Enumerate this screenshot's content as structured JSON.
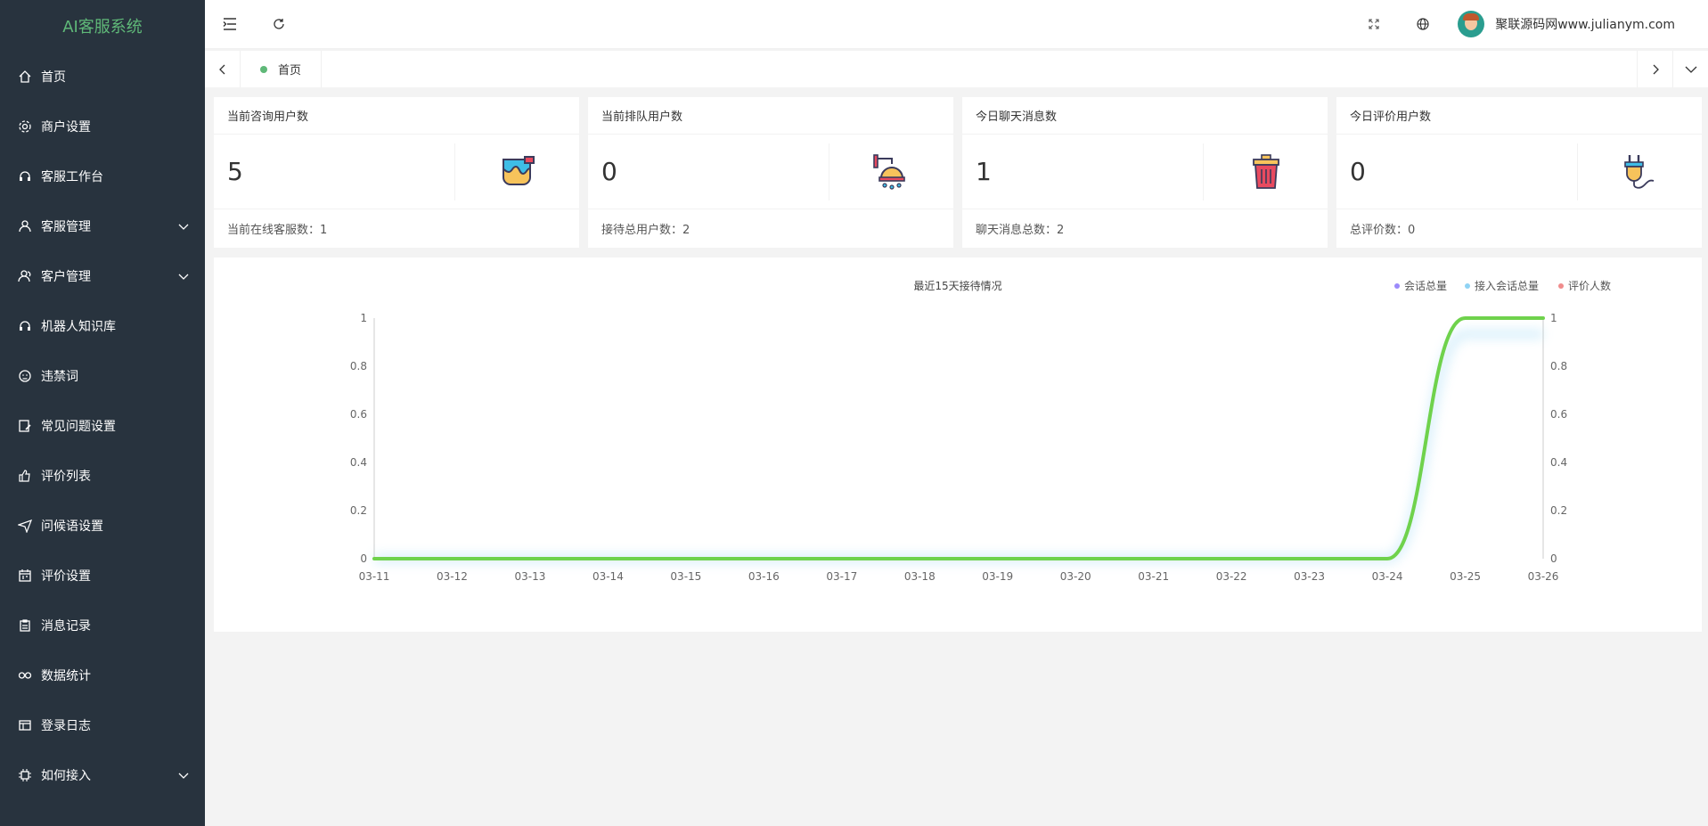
{
  "app": {
    "title": "AI客服系统"
  },
  "sidebar": {
    "items": [
      {
        "label": "首页",
        "icon": "home-icon",
        "expandable": false
      },
      {
        "label": "商户设置",
        "icon": "gear-icon",
        "expandable": false
      },
      {
        "label": "客服工作台",
        "icon": "headset-icon",
        "expandable": false
      },
      {
        "label": "客服管理",
        "icon": "user-icon",
        "expandable": true
      },
      {
        "label": "客户管理",
        "icon": "users-icon",
        "expandable": true
      },
      {
        "label": "机器人知识库",
        "icon": "robot-icon",
        "expandable": false
      },
      {
        "label": "违禁词",
        "icon": "face-icon",
        "expandable": false
      },
      {
        "label": "常见问题设置",
        "icon": "edit-icon",
        "expandable": false
      },
      {
        "label": "评价列表",
        "icon": "thumb-up-icon",
        "expandable": false
      },
      {
        "label": "问候语设置",
        "icon": "paper-plane-icon",
        "expandable": false
      },
      {
        "label": "评价设置",
        "icon": "calendar-icon",
        "expandable": false
      },
      {
        "label": "消息记录",
        "icon": "clipboard-icon",
        "expandable": false
      },
      {
        "label": "数据统计",
        "icon": "link-icon",
        "expandable": false
      },
      {
        "label": "登录日志",
        "icon": "table-icon",
        "expandable": false
      },
      {
        "label": "如何接入",
        "icon": "chip-icon",
        "expandable": true
      }
    ]
  },
  "header": {
    "user_name": "聚联源码网www.julianym.com"
  },
  "tabs": [
    {
      "label": "首页",
      "active": true
    }
  ],
  "cards": [
    {
      "title": "当前咨询用户数",
      "value": "5",
      "footer": "当前在线客服数：1",
      "icon": "paint-bucket-icon"
    },
    {
      "title": "当前排队用户数",
      "value": "0",
      "footer": "接待总用户数：2",
      "icon": "shower-icon"
    },
    {
      "title": "今日聊天消息数",
      "value": "1",
      "footer": "聊天消息总数：2",
      "icon": "trash-bin-icon"
    },
    {
      "title": "今日评价用户数",
      "value": "0",
      "footer": "总评价数：0",
      "icon": "plug-icon"
    }
  ],
  "chart_data": {
    "type": "line",
    "title": "最近15天接待情况",
    "x": [
      "03-11",
      "03-12",
      "03-13",
      "03-14",
      "03-15",
      "03-16",
      "03-17",
      "03-18",
      "03-19",
      "03-20",
      "03-21",
      "03-22",
      "03-23",
      "03-24",
      "03-25",
      "03-26"
    ],
    "series": [
      {
        "name": "会话总量",
        "color": "#9b8afb",
        "values": [
          0,
          0,
          0,
          0,
          0,
          0,
          0,
          0,
          0,
          0,
          0,
          0,
          0,
          0,
          1,
          1
        ]
      },
      {
        "name": "接入会话总量",
        "color": "#8fd3f4",
        "values": [
          0,
          0,
          0,
          0,
          0,
          0,
          0,
          0,
          0,
          0,
          0,
          0,
          0,
          0,
          1,
          1
        ]
      },
      {
        "name": "评价人数",
        "color": "#f08c8c",
        "values": [
          0,
          0,
          0,
          0,
          0,
          0,
          0,
          0,
          0,
          0,
          0,
          0,
          0,
          0,
          0,
          0
        ]
      }
    ],
    "ylim": [
      0,
      1
    ],
    "yticks": [
      "0",
      "0.2",
      "0.4",
      "0.6",
      "0.8",
      "1"
    ],
    "legend": "top-right",
    "smooth": true
  }
}
